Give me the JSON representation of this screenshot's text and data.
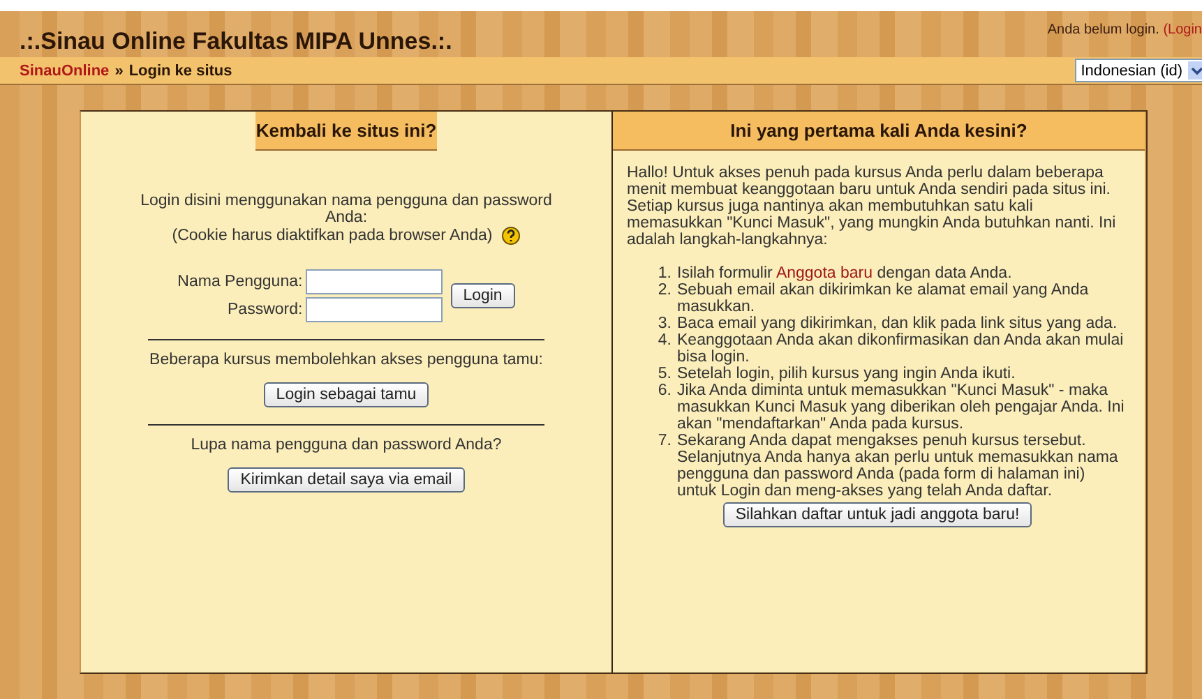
{
  "header": {
    "title": ".:.Sinau Online Fakultas MIPA Unnes.:.",
    "login_status": "Anda belum login.",
    "login_link": "(Login"
  },
  "breadcrumb": {
    "home": "SinauOnline",
    "separator": "»",
    "current": "Login ke situs"
  },
  "language_select": {
    "value": "Indonesian (id)"
  },
  "left_panel": {
    "heading": "Kembali ke situs ini?",
    "intro": "Login disini menggunakan nama pengguna dan password Anda:",
    "cookie_note": "(Cookie harus diaktifkan pada browser Anda)",
    "username_label": "Nama Pengguna:",
    "password_label": "Password:",
    "login_button": "Login",
    "guest_note": "Beberapa kursus membolehkan akses pengguna tamu:",
    "guest_button": "Login sebagai tamu",
    "forgot_note": "Lupa nama pengguna dan password Anda?",
    "forgot_button": "Kirimkan detail saya via email"
  },
  "right_panel": {
    "heading": "Ini yang pertama kali Anda kesini?",
    "intro": "Hallo! Untuk akses penuh pada kursus Anda perlu dalam beberapa menit membuat keanggotaan baru untuk Anda sendiri pada situs ini. Setiap kursus juga nantinya akan membutuhkan satu kali memasukkan \"Kunci Masuk\", yang mungkin Anda butuhkan nanti. Ini adalah langkah-langkahnya:",
    "steps": [
      {
        "number": "1.",
        "text": "Isilah formulir ",
        "link": "Anggota baru",
        "after": " dengan data Anda."
      },
      {
        "number": "2.",
        "text": "Sebuah email akan dikirimkan ke alamat email yang Anda masukkan."
      },
      {
        "number": "3.",
        "text": "Baca email yang dikirimkan, dan klik pada link situs yang ada."
      },
      {
        "number": "4.",
        "text": "Keanggotaan Anda akan dikonfirmasikan dan Anda akan mulai bisa login."
      },
      {
        "number": "5.",
        "text": "Setelah login, pilih kursus yang ingin Anda ikuti."
      },
      {
        "number": "6.",
        "text": "Jika Anda diminta untuk memasukkan \"Kunci Masuk\" - maka masukkan Kunci Masuk yang diberikan oleh pengajar Anda. Ini akan \"mendaftarkan\" Anda pada kursus."
      },
      {
        "number": "7.",
        "text": "Sekarang Anda dapat mengakses penuh kursus tersebut. Selanjutnya Anda hanya akan perlu untuk memasukkan nama pengguna dan password Anda (pada form di halaman ini) untuk Login dan meng-akses yang telah Anda daftar."
      }
    ],
    "signup_button": "Silahkan daftar untuk jadi anggota baru!"
  }
}
